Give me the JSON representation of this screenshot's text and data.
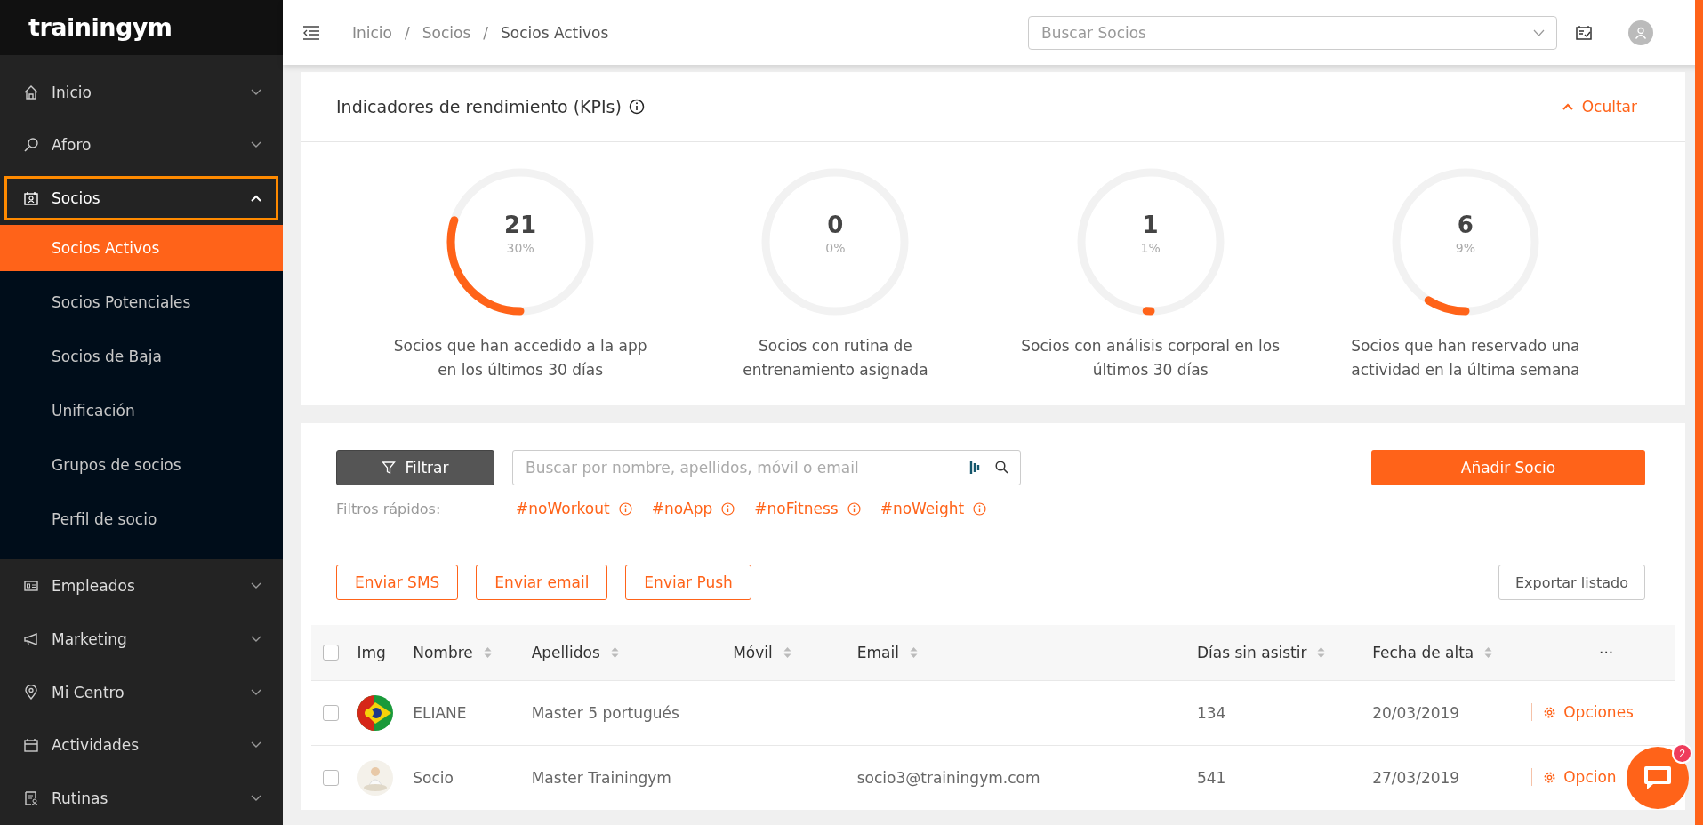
{
  "sidebar": {
    "logo": "trainingym",
    "items": [
      {
        "label": "Inicio",
        "expanded": false,
        "selected": false
      },
      {
        "label": "Aforo",
        "expanded": false,
        "selected": false
      },
      {
        "label": "Socios",
        "expanded": true,
        "selected": true,
        "children": [
          {
            "label": "Socios Activos",
            "selected": true
          },
          {
            "label": "Socios Potenciales",
            "selected": false
          },
          {
            "label": "Socios de Baja",
            "selected": false
          },
          {
            "label": "Unificación",
            "selected": false
          },
          {
            "label": "Grupos de socios",
            "selected": false
          },
          {
            "label": "Perfil de socio",
            "selected": false
          }
        ]
      },
      {
        "label": "Empleados",
        "expanded": false,
        "selected": false
      },
      {
        "label": "Marketing",
        "expanded": false,
        "selected": false
      },
      {
        "label": "Mi Centro",
        "expanded": false,
        "selected": false
      },
      {
        "label": "Actividades",
        "expanded": false,
        "selected": false
      },
      {
        "label": "Rutinas",
        "expanded": false,
        "selected": false
      }
    ]
  },
  "header": {
    "breadcrumb": [
      "Inicio",
      "Socios",
      "Socios Activos"
    ],
    "separator": "/",
    "search": {
      "placeholder": "Buscar Socios"
    }
  },
  "kpis": {
    "title": "Indicadores de rendimiento (KPIs)",
    "toggle": "Ocultar",
    "items": [
      {
        "value": "21",
        "percent": "30%",
        "level": 0.3,
        "label_lines": [
          "Socios que han accedido a la app",
          "en los últimos 30 días"
        ]
      },
      {
        "value": "0",
        "percent": "0%",
        "level": 0,
        "label_lines": [
          "Socios con rutina de",
          "entrenamiento asignada"
        ]
      },
      {
        "value": "1",
        "percent": "1%",
        "level": 0.01,
        "label_lines": [
          "Socios con análisis corporal en los",
          "últimos 30 días"
        ]
      },
      {
        "value": "6",
        "percent": "9%",
        "level": 0.09,
        "label_lines": [
          "Socios que han reservado una",
          "actividad en la última semana"
        ]
      }
    ]
  },
  "filters": {
    "filter_button": "Filtrar",
    "search": {
      "placeholder": "Buscar por nombre, apellidos, móvil o email"
    },
    "add_button": "Añadir Socio",
    "quick_label": "Filtros rápidos:",
    "quick_filters": [
      "#noWorkout",
      "#noApp",
      "#noFitness",
      "#noWeight"
    ],
    "actions": [
      "Enviar SMS",
      "Enviar email",
      "Enviar Push"
    ],
    "export_button": "Exportar listado"
  },
  "table": {
    "all_checked": false,
    "columns": [
      {
        "label": "Img",
        "sortable": false
      },
      {
        "label": "Nombre",
        "sortable": true
      },
      {
        "label": "Apellidos",
        "sortable": true
      },
      {
        "label": "Móvil",
        "sortable": true
      },
      {
        "label": "Email",
        "sortable": true
      },
      {
        "label": "Días sin asistir",
        "sortable": true
      },
      {
        "label": "Fecha de alta",
        "sortable": true
      },
      {
        "label": "···",
        "sortable": false
      }
    ],
    "rows": [
      {
        "checked": false,
        "kind": "flag",
        "nombre": "ELIANE",
        "apellidos": "Master 5 portugués",
        "dias": "134",
        "fecha": "20/03/2019",
        "options": "Opciones"
      },
      {
        "checked": false,
        "kind": "person",
        "nombre": "Socio",
        "apellidos": "Master Trainingym",
        "email": "socio3@trainingym.com",
        "dias": "541",
        "fecha": "27/03/2019",
        "options": "Opcion"
      }
    ]
  },
  "chat": {
    "badge": "2"
  }
}
